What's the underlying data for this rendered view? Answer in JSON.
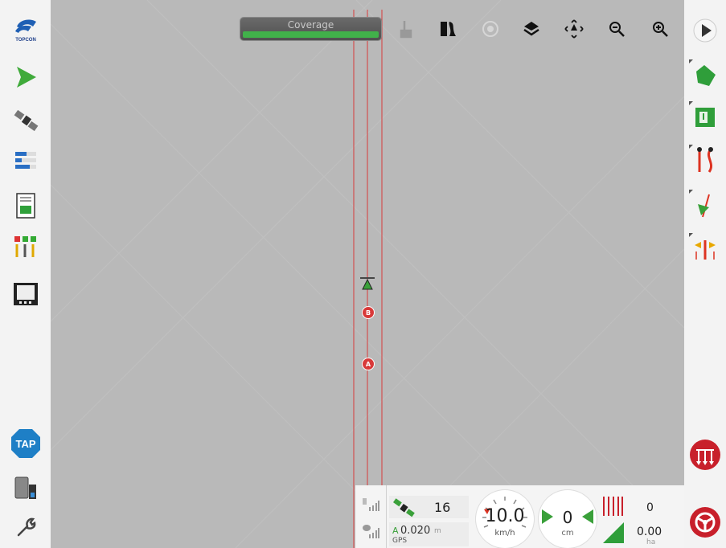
{
  "app": {
    "logo_text": "TOPCON"
  },
  "left_toolbar": {
    "items": [
      {
        "name": "logo",
        "icon": "topcon-logo-icon"
      },
      {
        "name": "run-guidance",
        "icon": "green-arrow-icon"
      },
      {
        "name": "gps-receiver",
        "icon": "satellite-icon"
      },
      {
        "name": "data-manager",
        "icon": "list-icon"
      },
      {
        "name": "status-monitor",
        "icon": "document-icon"
      },
      {
        "name": "section-control",
        "icon": "sections-icon"
      },
      {
        "name": "display",
        "icon": "display-icon"
      },
      {
        "name": "tap",
        "icon": "tap-icon",
        "label": "TAP"
      },
      {
        "name": "implement",
        "icon": "implement-icon"
      },
      {
        "name": "setup",
        "icon": "wrench-icon"
      }
    ]
  },
  "map_toolbar": {
    "coverage_label": "Coverage",
    "icons": [
      "touch-icon",
      "swath-icon",
      "record-icon",
      "layers-icon",
      "pan-icon",
      "zoom-out-icon",
      "zoom-in-icon"
    ]
  },
  "right_toolbar": {
    "icons": [
      "expand-icon",
      "field-boundary-icon",
      "headland-icon",
      "guidance-lines-icon",
      "marker-icon",
      "nudge-icon",
      "sections-auto-icon",
      "steer-icon"
    ]
  },
  "map": {
    "marker_b_label": "B",
    "marker_a_label": "A"
  },
  "status_bar": {
    "satellite_count": "16",
    "accuracy_value": "0.020",
    "accuracy_unit": "m",
    "accuracy_prefix": "A",
    "fix_label": "GPS",
    "speed_value": "10.0",
    "speed_unit": "km/h",
    "cross_track_value": "0",
    "cross_track_unit": "cm",
    "rows_count": "0",
    "area_value": "0.00",
    "area_unit": "ha"
  },
  "colors": {
    "accent_green": "#41b14a",
    "guide_red": "#d83a3a",
    "tap_blue": "#1e7fc6",
    "alert_red": "#c8202b"
  }
}
